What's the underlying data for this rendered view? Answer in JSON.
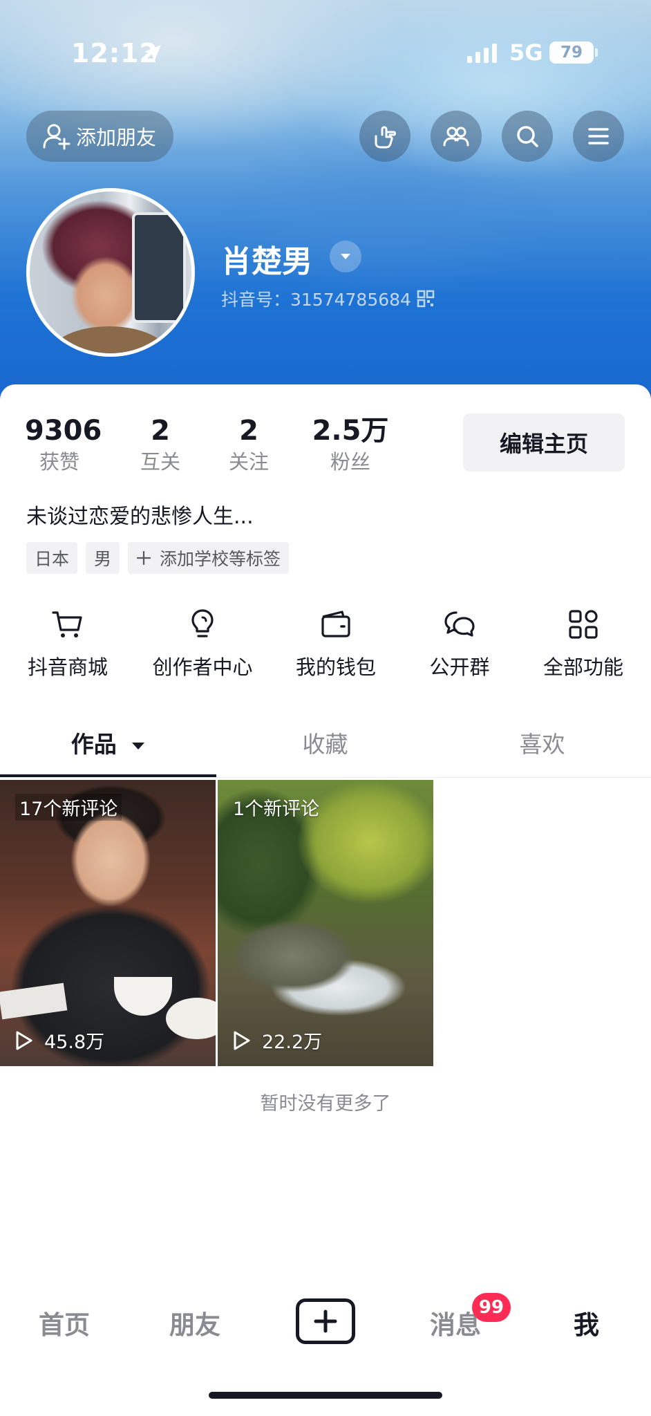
{
  "status_bar": {
    "time": "12:12",
    "network": "5G",
    "battery": "79"
  },
  "header": {
    "add_friend_label": "添加朋友",
    "icons": [
      "hand-point-icon",
      "people-icon",
      "search-icon",
      "menu-icon"
    ]
  },
  "profile": {
    "name": "肖楚男",
    "douyin_id": "抖音号：31574785684",
    "bio": "未谈过恋爱的悲惨人生...",
    "tags": [
      "日本",
      "男",
      "添加学校等标签"
    ]
  },
  "stats": [
    {
      "value": "9306",
      "label": "获赞"
    },
    {
      "value": "2",
      "label": "互关"
    },
    {
      "value": "2",
      "label": "关注"
    },
    {
      "value": "2.5万",
      "label": "粉丝"
    }
  ],
  "edit_button": "编辑主页",
  "functions": [
    {
      "label": "抖音商城",
      "icon": "cart-icon"
    },
    {
      "label": "创作者中心",
      "icon": "bulb-icon"
    },
    {
      "label": "我的钱包",
      "icon": "wallet-icon"
    },
    {
      "label": "公开群",
      "icon": "chat-group-icon"
    },
    {
      "label": "全部功能",
      "icon": "grid-apps-icon"
    }
  ],
  "tabs": [
    {
      "label": "作品",
      "active": true
    },
    {
      "label": "收藏",
      "active": false
    },
    {
      "label": "喜欢",
      "active": false
    }
  ],
  "videos": [
    {
      "comments": "17个新评论",
      "views": "45.8万"
    },
    {
      "comments": "1个新评论",
      "views": "22.2万"
    }
  ],
  "no_more_text": "暂时没有更多了",
  "bottom_nav": {
    "home": "首页",
    "friends": "朋友",
    "messages": "消息",
    "messages_badge": "99",
    "me": "我"
  },
  "colors": {
    "accent": "#fe2c55",
    "text": "#161823",
    "muted": "#8a8b91"
  }
}
